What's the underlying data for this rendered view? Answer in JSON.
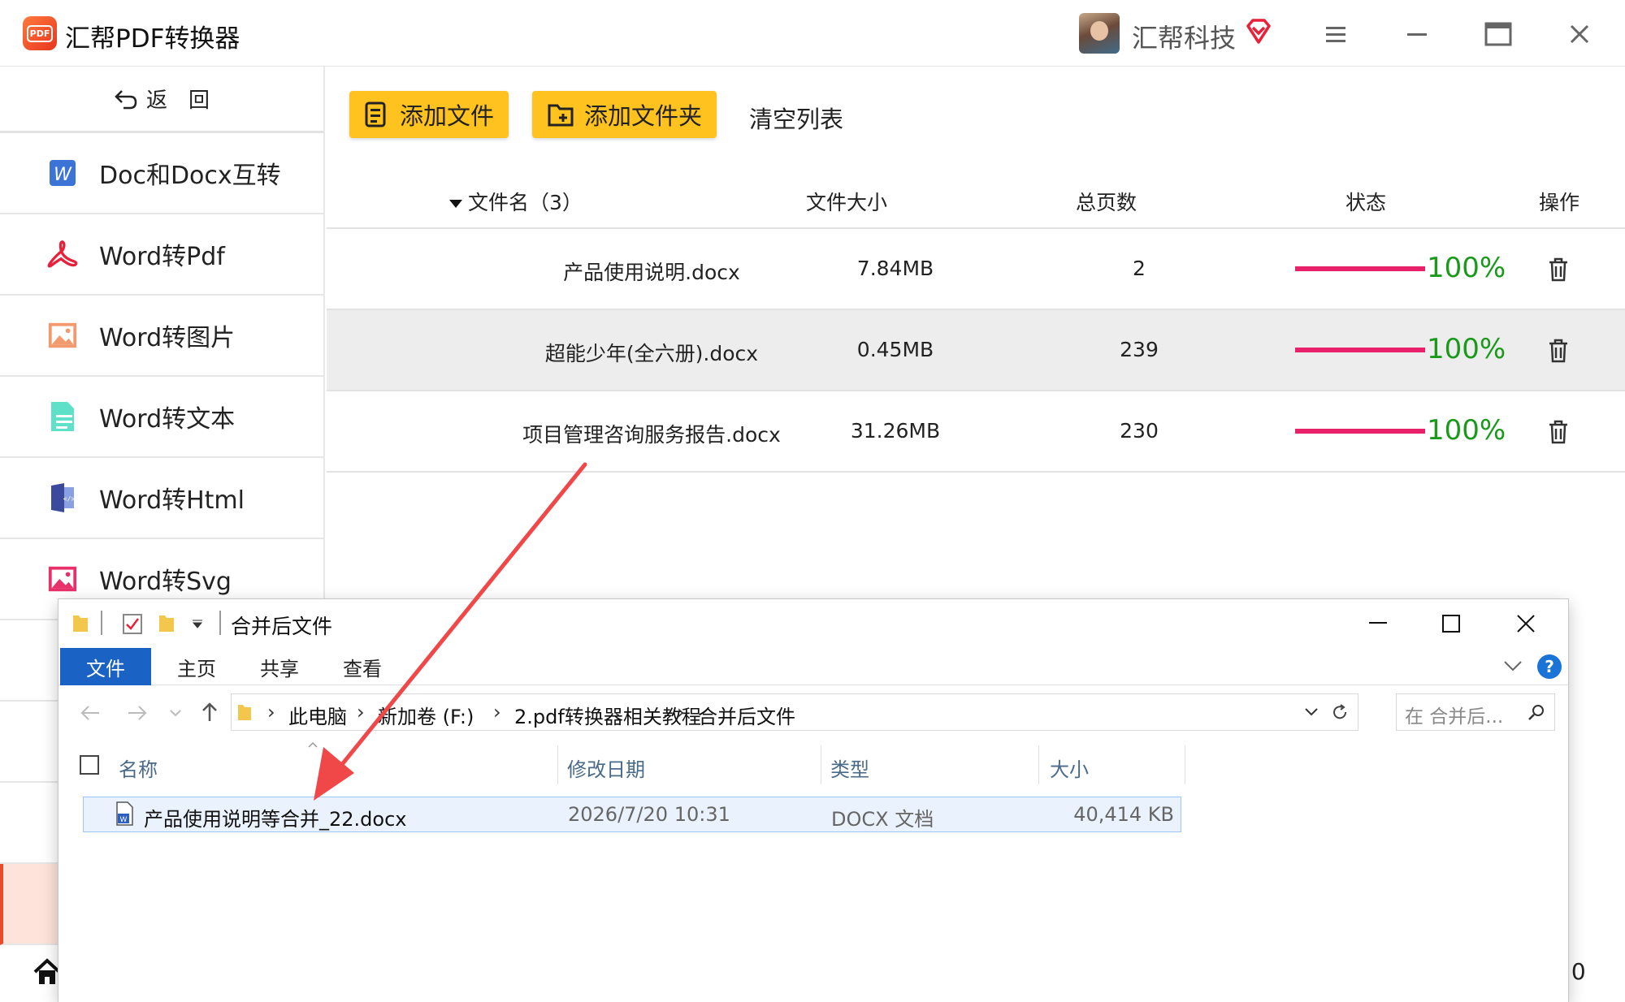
{
  "app": {
    "title": "汇帮PDF转换器",
    "logo_text": "PDF",
    "company": "汇帮科技"
  },
  "sidebar": {
    "back_label": "返　回",
    "items": [
      {
        "label": "Doc和Docx互转",
        "icon": "word-doc-icon"
      },
      {
        "label": "Word转Pdf",
        "icon": "pdf-icon"
      },
      {
        "label": "Word转图片",
        "icon": "image-icon"
      },
      {
        "label": "Word转文本",
        "icon": "text-doc-icon"
      },
      {
        "label": "Word转Html",
        "icon": "html-doc-icon"
      },
      {
        "label": "Word转Svg",
        "icon": "svg-image-icon"
      }
    ]
  },
  "toolbar": {
    "add_file": "添加文件",
    "add_folder": "添加文件夹",
    "clear_list": "清空列表"
  },
  "table": {
    "headers": {
      "name": "文件名（3）",
      "size": "文件大小",
      "pages": "总页数",
      "status": "状态",
      "action": "操作"
    },
    "rows": [
      {
        "name": "产品使用说明.docx",
        "size": "7.84MB",
        "pages": "2",
        "status": "100%",
        "progress": 1.0
      },
      {
        "name": "超能少年(全六册).docx",
        "size": "0.45MB",
        "pages": "239",
        "status": "100%",
        "progress": 1.0
      },
      {
        "name": "项目管理咨询服务报告.docx",
        "size": "31.26MB",
        "pages": "230",
        "status": "100%",
        "progress": 1.0
      }
    ]
  },
  "explorer": {
    "title": "合并后文件",
    "tabs": [
      "文件",
      "主页",
      "共享",
      "查看"
    ],
    "breadcrumb": [
      "此电脑",
      "新加卷 (F:)",
      "2.pdf转换器相关教程",
      "合并后文件"
    ],
    "search_placeholder": "在 合并后...",
    "columns": {
      "name": "名称",
      "date": "修改日期",
      "type": "类型",
      "size": "大小"
    },
    "files": [
      {
        "name": "产品使用说明等合并_22.docx",
        "date": "2026/7/20 10:31",
        "type": "DOCX 文档",
        "size": "40,414 KB"
      }
    ]
  },
  "footer": {
    "version_fragment": ".0"
  },
  "colors": {
    "accent": "#ffc21e",
    "progress": "#e8216a",
    "percent": "#1a9a1a",
    "ribbon_file": "#1a63c4",
    "arrow": "#f04848"
  }
}
